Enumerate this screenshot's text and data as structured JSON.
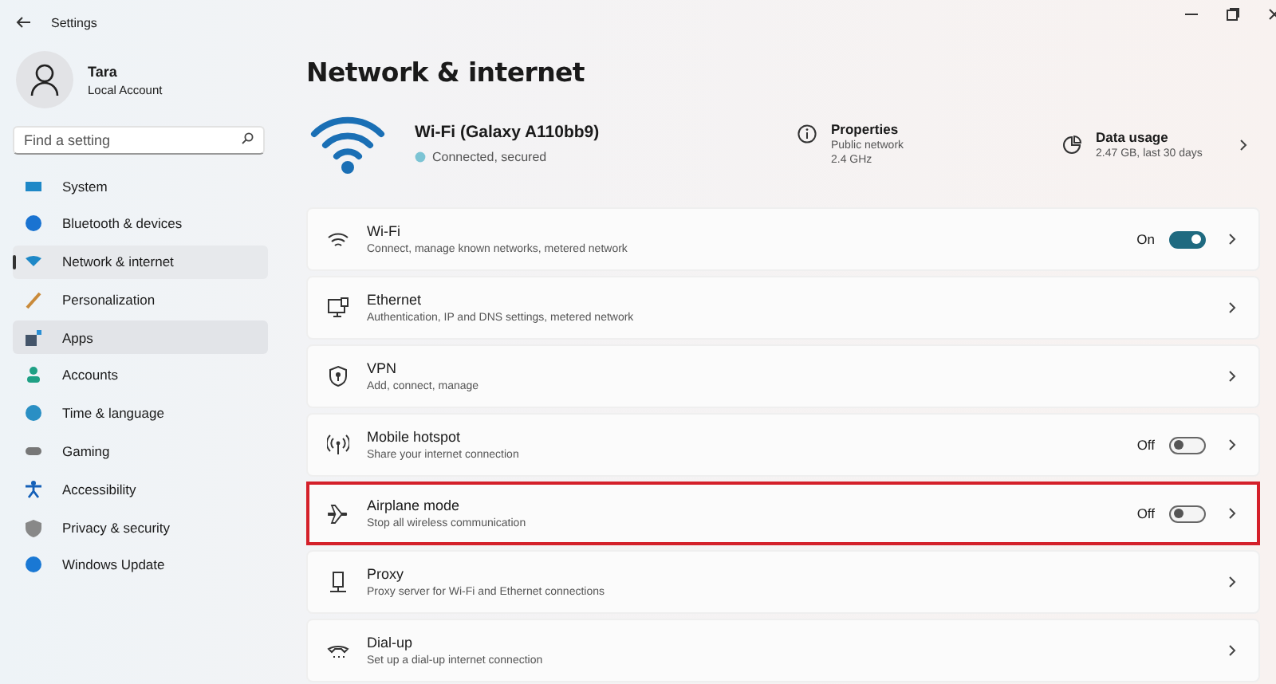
{
  "window": {
    "title": "Settings"
  },
  "account": {
    "name": "Tara",
    "type": "Local Account"
  },
  "search": {
    "placeholder": "Find a setting"
  },
  "sidebar": {
    "items": [
      {
        "label": "System",
        "selected": false,
        "hovered": false
      },
      {
        "label": "Bluetooth & devices",
        "selected": false,
        "hovered": false
      },
      {
        "label": "Network & internet",
        "selected": true,
        "hovered": false
      },
      {
        "label": "Personalization",
        "selected": false,
        "hovered": false
      },
      {
        "label": "Apps",
        "selected": false,
        "hovered": true
      },
      {
        "label": "Accounts",
        "selected": false,
        "hovered": false
      },
      {
        "label": "Time & language",
        "selected": false,
        "hovered": false
      },
      {
        "label": "Gaming",
        "selected": false,
        "hovered": false
      },
      {
        "label": "Accessibility",
        "selected": false,
        "hovered": false
      },
      {
        "label": "Privacy & security",
        "selected": false,
        "hovered": false
      },
      {
        "label": "Windows Update",
        "selected": false,
        "hovered": false
      }
    ]
  },
  "page": {
    "title": "Network & internet"
  },
  "connection": {
    "name": "Wi-Fi (Galaxy A110bb9)",
    "status": "Connected, secured",
    "properties": {
      "title": "Properties",
      "lines": [
        "Public network",
        "2.4 GHz"
      ]
    },
    "data_usage": {
      "title": "Data usage",
      "detail": "2.47 GB, last 30 days"
    }
  },
  "rows": [
    {
      "kind": "toggle",
      "title": "Wi-Fi",
      "subtitle": "Connect, manage known networks, metered network",
      "state_label": "On",
      "on": true,
      "highlighted": false
    },
    {
      "kind": "link",
      "title": "Ethernet",
      "subtitle": "Authentication, IP and DNS settings, metered network",
      "highlighted": false
    },
    {
      "kind": "link",
      "title": "VPN",
      "subtitle": "Add, connect, manage",
      "highlighted": false
    },
    {
      "kind": "toggle",
      "title": "Mobile hotspot",
      "subtitle": "Share your internet connection",
      "state_label": "Off",
      "on": false,
      "highlighted": false
    },
    {
      "kind": "toggle",
      "title": "Airplane mode",
      "subtitle": "Stop all wireless communication",
      "state_label": "Off",
      "on": false,
      "highlighted": true
    },
    {
      "kind": "link",
      "title": "Proxy",
      "subtitle": "Proxy server for Wi-Fi and Ethernet connections",
      "highlighted": false
    },
    {
      "kind": "link",
      "title": "Dial-up",
      "subtitle": "Set up a dial-up internet connection",
      "highlighted": false
    }
  ]
}
